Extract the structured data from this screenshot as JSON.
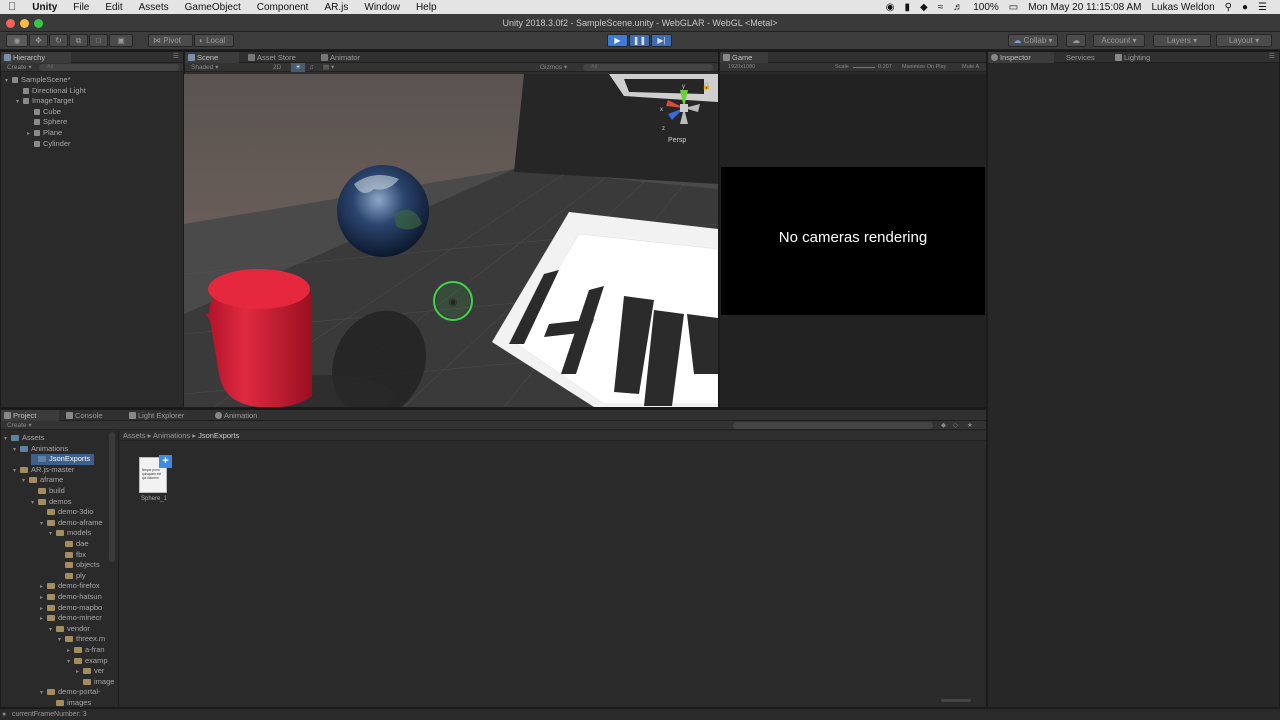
{
  "menubar": {
    "apple": "",
    "app": "Unity",
    "items": [
      "File",
      "Edit",
      "Assets",
      "GameObject",
      "Component",
      "AR.js",
      "Window",
      "Help"
    ],
    "battery": "100%",
    "datetime": "Mon May 20  11:15:08 AM",
    "user": "Lukas Weldon"
  },
  "window": {
    "title": "Unity 2018.3.0f2 - SampleScene.unity - WebGLAR - WebGL <Metal>"
  },
  "toolbar": {
    "pivot": "Pivot",
    "local": "Local",
    "collab": "Collab",
    "account": "Account",
    "layers": "Layers",
    "layout": "Layout"
  },
  "hierarchy": {
    "tab": "Hierarchy",
    "create": "Create",
    "search_placeholder": "All",
    "items": [
      {
        "label": "SampleScene*",
        "depth": 0,
        "icon": "unity-scene-icon",
        "arrow": "▾"
      },
      {
        "label": "Directional Light",
        "depth": 1,
        "icon": "cube-icon",
        "arrow": ""
      },
      {
        "label": "ImageTarget",
        "depth": 1,
        "icon": "cube-icon",
        "arrow": "▾"
      },
      {
        "label": "Cube",
        "depth": 2,
        "icon": "cube-icon",
        "arrow": ""
      },
      {
        "label": "Sphere",
        "depth": 2,
        "icon": "cube-icon",
        "arrow": ""
      },
      {
        "label": "Plane",
        "depth": 2,
        "icon": "cube-icon",
        "arrow": "▸"
      },
      {
        "label": "Cylinder",
        "depth": 2,
        "icon": "cube-icon",
        "arrow": ""
      }
    ]
  },
  "scene": {
    "tabs": [
      "Scene",
      "Asset Store",
      "Animator"
    ],
    "shading": "Shaded",
    "mode2d": "2D",
    "gizmos": "Gizmos",
    "search_placeholder": "All",
    "persp": "Persp",
    "gizmo_axes": [
      "y",
      "x",
      "z"
    ],
    "floor_text": "Hi"
  },
  "game": {
    "tab": "Game",
    "resolution": "1920x1080",
    "scale_label": "Scale",
    "scale_value": "0.207",
    "maximize": "Maximize On Play",
    "mute": "Mute A",
    "message": "No cameras rendering"
  },
  "inspector": {
    "tabs": [
      "Inspector",
      "Services",
      "Lighting"
    ]
  },
  "project": {
    "tabs": [
      "Project",
      "Console",
      "Light Explorer",
      "Animation"
    ],
    "create": "Create",
    "breadcrumb": [
      "Assets",
      "Animations",
      "JsonExports"
    ],
    "tree": [
      {
        "label": "Assets",
        "depth": 0,
        "arrow": "▾",
        "color": "blue"
      },
      {
        "label": "Animations",
        "depth": 1,
        "arrow": "▾",
        "color": "blue"
      },
      {
        "label": "JsonExports",
        "depth": 2,
        "arrow": "",
        "color": "blue",
        "selected": true
      },
      {
        "label": "AR.js-master",
        "depth": 1,
        "arrow": "▾",
        "color": "tan"
      },
      {
        "label": "aframe",
        "depth": 2,
        "arrow": "▾",
        "color": "tan"
      },
      {
        "label": "build",
        "depth": 3,
        "arrow": "",
        "color": "tan"
      },
      {
        "label": "demos",
        "depth": 3,
        "arrow": "▾",
        "color": "tan"
      },
      {
        "label": "demo-3dio",
        "depth": 4,
        "arrow": "",
        "color": "tan"
      },
      {
        "label": "demo-aframe",
        "depth": 4,
        "arrow": "▾",
        "color": "tan"
      },
      {
        "label": "models",
        "depth": 5,
        "arrow": "▾",
        "color": "tan"
      },
      {
        "label": "dae",
        "depth": 6,
        "arrow": "",
        "color": "tan"
      },
      {
        "label": "fbx",
        "depth": 6,
        "arrow": "",
        "color": "tan"
      },
      {
        "label": "objects",
        "depth": 6,
        "arrow": "",
        "color": "tan"
      },
      {
        "label": "ply",
        "depth": 6,
        "arrow": "",
        "color": "tan"
      },
      {
        "label": "demo-firefox",
        "depth": 4,
        "arrow": "▸",
        "color": "tan"
      },
      {
        "label": "demo-hatsun",
        "depth": 4,
        "arrow": "▸",
        "color": "tan"
      },
      {
        "label": "demo-mapbo",
        "depth": 4,
        "arrow": "▸",
        "color": "tan"
      },
      {
        "label": "demo-minecr",
        "depth": 4,
        "arrow": "▸",
        "color": "tan"
      },
      {
        "label": "vendor",
        "depth": 5,
        "arrow": "▾",
        "color": "tan"
      },
      {
        "label": "threex.m",
        "depth": 6,
        "arrow": "▾",
        "color": "tan"
      },
      {
        "label": "a-fran",
        "depth": 7,
        "arrow": "▸",
        "color": "tan"
      },
      {
        "label": "examp",
        "depth": 7,
        "arrow": "▾",
        "color": "tan"
      },
      {
        "label": "ver",
        "depth": 8,
        "arrow": "▸",
        "color": "tan"
      },
      {
        "label": "image",
        "depth": 8,
        "arrow": "",
        "color": "tan"
      },
      {
        "label": "demo-portal-",
        "depth": 4,
        "arrow": "▾",
        "color": "tan"
      },
      {
        "label": "images",
        "depth": 5,
        "arrow": "",
        "color": "tan"
      }
    ],
    "asset": {
      "name": "Sphere_1",
      "preview_text": "Neque porro quisquam est qui dolorem"
    }
  },
  "status": {
    "text": "currentFrameNumber: 3"
  },
  "colors": {
    "accent_blue": "#3e5f8a",
    "play_blue": "#3d7bd9",
    "cylinder_red": "#d8203a",
    "cursor_green": "#3dd84a"
  }
}
